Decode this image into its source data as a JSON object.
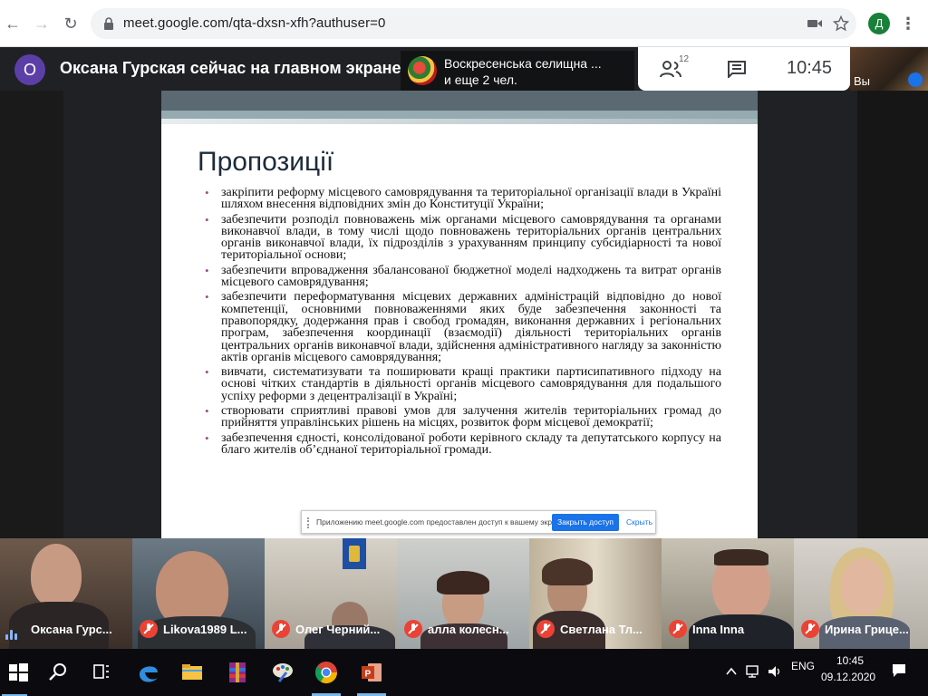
{
  "browser": {
    "url": "meet.google.com/qta-dxsn-xfh?authuser=0",
    "profile_initial": "Д",
    "icons": [
      "back-arrow-icon",
      "forward-arrow-icon",
      "reload-icon",
      "lock-icon",
      "camera-icon",
      "star-icon",
      "more-vert-icon"
    ]
  },
  "meet": {
    "presenter_initial": "О",
    "presenter_title": "Оксана Гурская сейчас на главном экране",
    "others_line1": "Воскресенська селищна ...",
    "others_line2": "и еще 2 чел.",
    "participant_count": "12",
    "clock": "10:45",
    "you_label": "Вы"
  },
  "slide": {
    "title": "Пропозиції",
    "bullets": [
      "закріпити реформу місцевого самоврядування та територіальної організації влади в Україні шляхом внесення відповідних змін до Конституції України;",
      "забезпечити розподіл повноважень між органами місцевого самоврядування та органами виконавчої влади, в тому числі щодо повноважень територіальних органів центральних органів виконавчої влади, їх підрозділів з урахуванням принципу субсидіарності та нової територіальної основи;",
      "забезпечити впровадження збалансованої бюджетної моделі надходжень та витрат органів місцевого самоврядування;",
      "забезпечити переформатування місцевих державних адміністрацій відповідно до нової компетенції, основними повноваженнями яких буде забезпечення законності та правопорядку, додержання прав і свобод громадян, виконання державних і регіональних програм, забезпечення координації (взаємодії) діяльності територіальних органів центральних органів виконавчої влади, здійснення адміністративного нагляду за законністю актів органів місцевого самоврядування;",
      " вивчати, систематизувати та поширювати кращі практики партисипативного підходу на основі чітких стандартів в діяльності органів місцевого самоврядування для подальшого успіху реформи з децентралізації в Україні;",
      " створювати сприятливі правові умов для залучення жителів територіальних громад до прийняття управлінських рішень на місцях, розвиток форм місцевої демократії;",
      " забезпечення єдності, консолідованої роботи керівного складу та депутатського корпусу на благо жителів об’єднаної територіальної громади."
    ],
    "share_bar_text": "Приложению meet.google.com предоставлен доступ к вашему экрану.",
    "share_bar_button": "Закрыть доступ",
    "share_bar_hide": "Скрыть"
  },
  "participants": [
    {
      "name": "Оксана Гурс...",
      "muted": false
    },
    {
      "name": "Likova1989 L...",
      "muted": true
    },
    {
      "name": "Олег Черний...",
      "muted": true
    },
    {
      "name": "алла колесн...",
      "muted": true
    },
    {
      "name": "Светлана Тл...",
      "muted": true
    },
    {
      "name": "Inna Inna",
      "muted": true
    },
    {
      "name": "Ирина Грице...",
      "muted": true
    }
  ],
  "taskbar": {
    "apps": [
      "windows-start-icon",
      "search-icon",
      "task-view-icon",
      "edge-icon",
      "file-explorer-icon",
      "winrar-icon",
      "paint-icon",
      "chrome-icon",
      "powerpoint-icon"
    ],
    "lang": "ENG",
    "time": "10:45",
    "date": "09.12.2020"
  }
}
